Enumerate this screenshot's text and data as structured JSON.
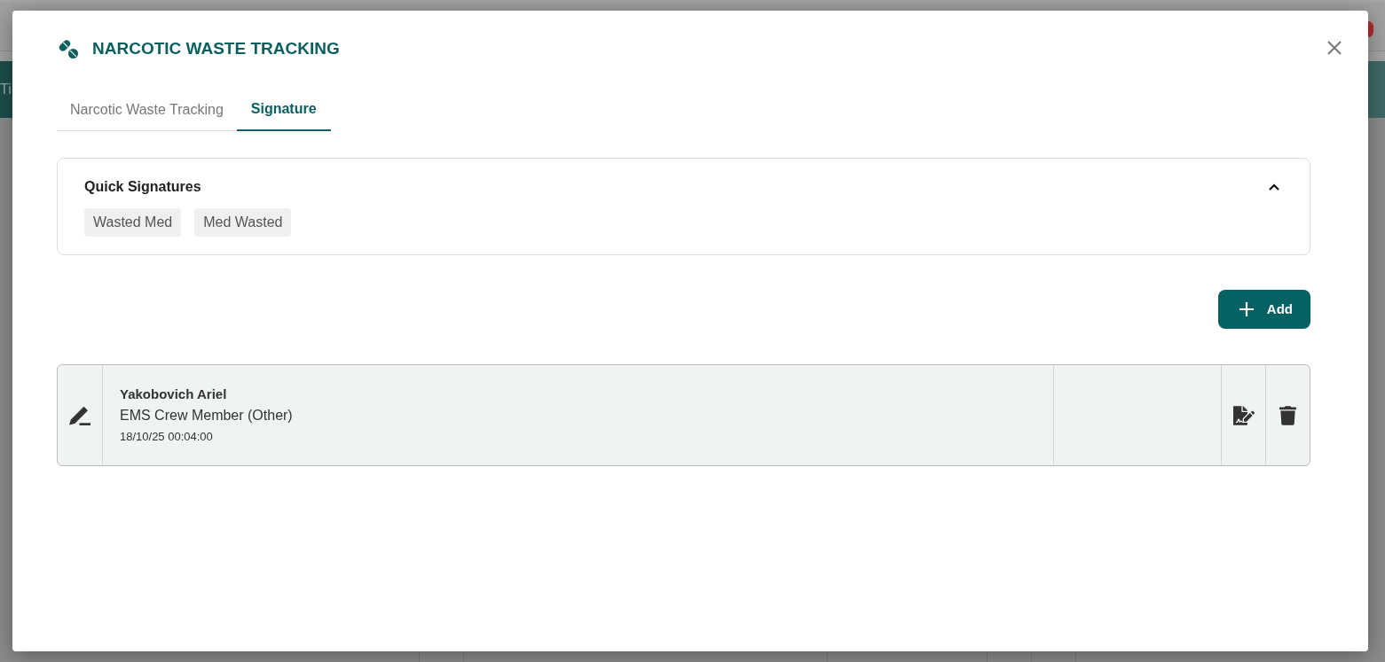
{
  "background": {
    "header_text": "Ti"
  },
  "window": {
    "title": "NARCOTIC WASTE TRACKING"
  },
  "tabs": [
    {
      "label": "Narcotic Waste Tracking",
      "selected": false
    },
    {
      "label": "Signature",
      "selected": true
    }
  ],
  "quick_signatures": {
    "title": "Quick Signatures",
    "expanded": true,
    "items": [
      "Wasted Med",
      "Med Wasted"
    ]
  },
  "add_button": {
    "label": "Add"
  },
  "signatures": [
    {
      "name": "Yakobovich Ariel",
      "role": "EMS Crew Member (Other)",
      "time": "18/10/25 00:04:00"
    }
  ]
}
